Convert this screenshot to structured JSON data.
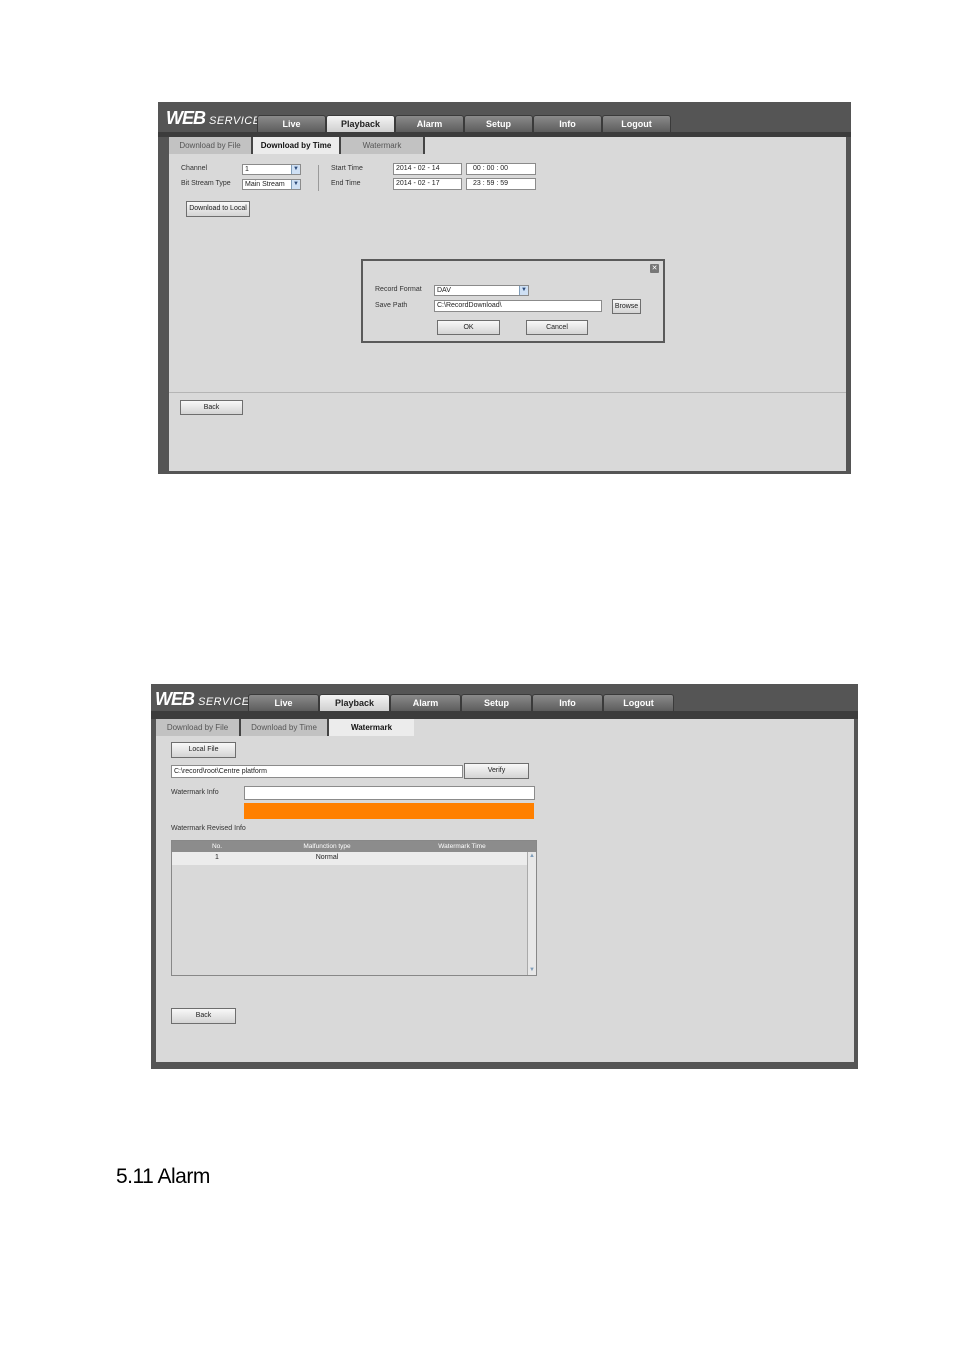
{
  "shots": [
    {
      "logo_main": "WEB",
      "logo_sub": "SERVICE",
      "top_tabs": [
        "Live",
        "Playback",
        "Alarm",
        "Setup",
        "Info",
        "Logout"
      ],
      "active_top_tab": "Playback",
      "sub_tabs": [
        "Download by File",
        "Download by Time",
        "Watermark"
      ],
      "active_sub_tab": "Download by Time",
      "channel_label": "Channel",
      "channel_value": "1",
      "stream_label": "Bit Stream Type",
      "stream_value": "Main Stream",
      "start_label": "Start Time",
      "start_date": "2014 -  02  -  14",
      "start_time": "00   :   00   :   00",
      "end_label": "End Time",
      "end_date": "2014 -  02  -  17",
      "end_time": "23   :   59   :   59",
      "download_button": "Download to Local",
      "dialog": {
        "format_label": "Record Format",
        "format_value": "DAV",
        "path_label": "Save Path",
        "path_value": "C:\\RecordDownload\\",
        "browse_button": "Browse",
        "ok_button": "OK",
        "cancel_button": "Cancel"
      },
      "back_button": "Back"
    },
    {
      "logo_main": "WEB",
      "logo_sub": "SERVICE",
      "top_tabs": [
        "Live",
        "Playback",
        "Alarm",
        "Setup",
        "Info",
        "Logout"
      ],
      "active_top_tab": "Playback",
      "sub_tabs": [
        "Download by File",
        "Download by Time",
        "Watermark"
      ],
      "active_sub_tab": "Watermark",
      "local_file_button": "Local File",
      "file_path": "C:\\record\\root\\Centre platform",
      "verify_button": "Verify",
      "watermark_info_label": "Watermark Info",
      "watermark_revised_label": "Watermark Revised Info",
      "table_headers": [
        "No.",
        "Malfunction type",
        "Watermark Time"
      ],
      "table_rows": [
        [
          "1",
          "Normal",
          ""
        ]
      ],
      "progress_color": "#ff8000",
      "back_button": "Back"
    }
  ],
  "section_heading": "5.11 Alarm"
}
